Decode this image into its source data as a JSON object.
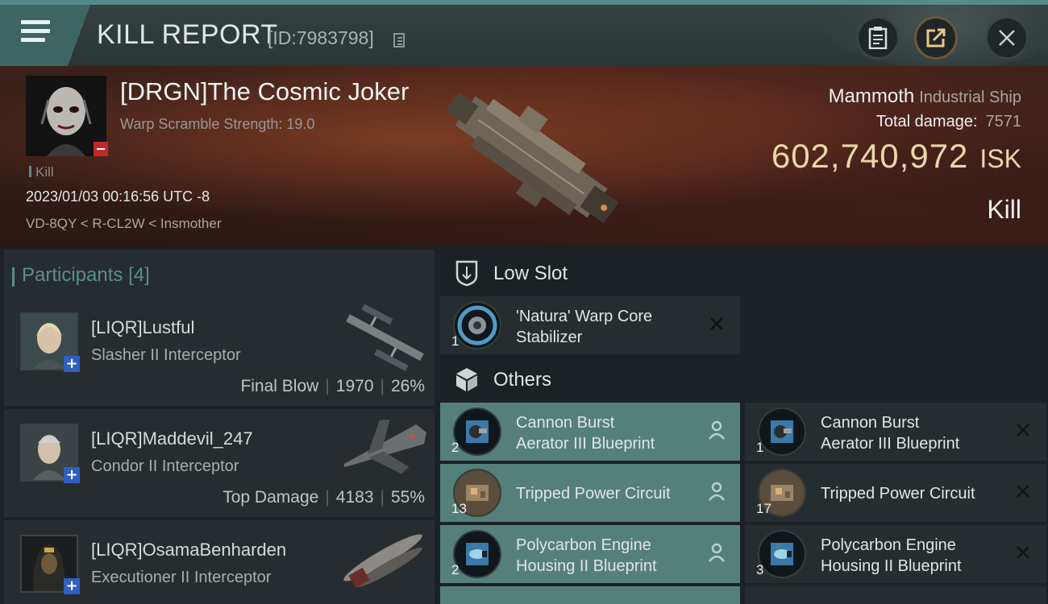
{
  "header": {
    "title": "KILL REPORT",
    "report_id": "[ID:7983798]"
  },
  "victim": {
    "name": "[DRGN]The Cosmic Joker",
    "scramble": "Warp Scramble Strength: 19.0",
    "tag": "Kill",
    "datetime": "2023/01/03 00:16:56 UTC -8",
    "location": "VD-8QY < R-CL2W < Insmother",
    "ship_name": "Mammoth",
    "ship_class": "Industrial Ship",
    "damage_label": "Total damage:",
    "damage_value": "7571",
    "isk_amount": "602,740,972",
    "isk_unit": "ISK",
    "kill_type": "Kill"
  },
  "participants": {
    "label": "Participants",
    "count": "[4]",
    "list": [
      {
        "name": "[LIQR]Lustful",
        "ship": "Slasher II Interceptor",
        "role": "Final Blow",
        "damage": "1970",
        "percent": "26%"
      },
      {
        "name": "[LIQR]Maddevil_247",
        "ship": "Condor II Interceptor",
        "role": "Top Damage",
        "damage": "4183",
        "percent": "55%"
      },
      {
        "name": "[LIQR]OsamaBenharden",
        "ship": "Executioner II Interceptor"
      }
    ]
  },
  "fitting": {
    "low_slot_label": "Low Slot",
    "others_label": "Others",
    "low_slot": {
      "line1": "'Natura' Warp Core",
      "line2": "Stabilizer",
      "qty": "1"
    },
    "others_dropped": [
      {
        "line1": "Cannon Burst",
        "line2": "Aerator III Blueprint",
        "qty": "2"
      },
      {
        "line1": "Tripped Power Circuit",
        "line2": "",
        "qty": "13"
      },
      {
        "line1": "Polycarbon Engine",
        "line2": "Housing II Blueprint",
        "qty": "2"
      }
    ],
    "others_destroyed": [
      {
        "line1": "Cannon Burst",
        "line2": "Aerator III Blueprint",
        "qty": "1"
      },
      {
        "line1": "Tripped Power Circuit",
        "line2": "",
        "qty": "17"
      },
      {
        "line1": "Polycarbon Engine",
        "line2": "Housing II Blueprint",
        "qty": "3"
      }
    ]
  },
  "colors": {
    "accent_teal": "#5c8e89",
    "dropped_bg": "#558079",
    "isk_gold": "#e9d7a9",
    "minus_red": "#c0282a",
    "plus_blue": "#2f5fc0"
  },
  "icons": [
    "menu-icon",
    "copy-icon",
    "clipboard-icon",
    "share-icon",
    "close-icon",
    "shield-icon",
    "box-icon",
    "person-icon",
    "x-icon"
  ]
}
